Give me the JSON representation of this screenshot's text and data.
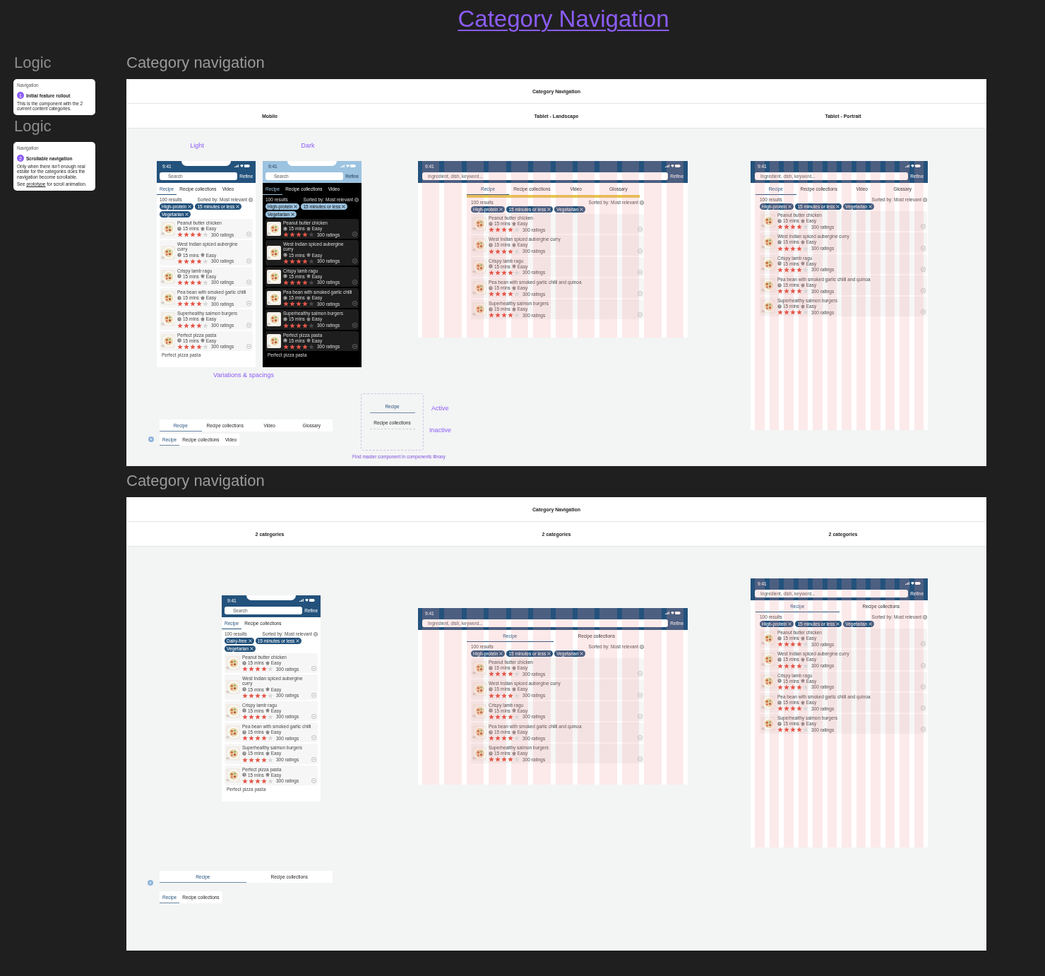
{
  "page_title": "Category Navigation",
  "logic": {
    "headings": [
      "Logic",
      "Logic"
    ],
    "cards": [
      {
        "heading": "Navigation",
        "number": "1",
        "title": "Initial feature rollout",
        "paragraphs": [
          {
            "text": "This is the component with the 2 current content categories."
          }
        ]
      },
      {
        "heading": "Navigation",
        "number": "2",
        "title": "Scrollable navigation",
        "paragraphs": [
          {
            "text": "Only when there isn't enough real estate for the categories does the navigation become scrollable."
          },
          {
            "before": "See ",
            "link": "prototype",
            "after": " for scroll animation."
          }
        ]
      }
    ]
  },
  "sections": [
    {
      "heading": "Category navigation",
      "board_title": "Category Navigation",
      "columns": [
        "Mobile",
        "Tablet - Landscape",
        "Tablet - Portrait"
      ],
      "labels": [
        "Light",
        "Dark",
        "Variations & spacings"
      ],
      "screens": [
        {
          "kind": "mobile",
          "dark": false,
          "grid": false,
          "highlight": false,
          "time": "9:41",
          "search_placeholder": "Search",
          "refine": "Refine",
          "tabs": [
            {
              "label": "Recipe",
              "selected": true
            },
            {
              "label": "Recipe collections",
              "selected": false
            },
            {
              "label": "Video",
              "selected": false
            }
          ],
          "results": "100 results",
          "sort": "Sorted by: Most relevant",
          "chips": [
            "High-protein",
            "15 minutes or less",
            "Vegetarian"
          ],
          "recipes": [
            {
              "name": "Peanut butter chicken",
              "time": "15 mins",
              "difficulty": "Easy",
              "stars": 4,
              "ratings": "300 ratings"
            },
            {
              "name": "West Indian spiced aubergine curry",
              "time": "15 mins",
              "difficulty": "Easy",
              "stars": 4,
              "ratings": "300 ratings"
            },
            {
              "name": "Crispy lamb ragu",
              "time": "15 mins",
              "difficulty": "Easy",
              "stars": 4,
              "ratings": "300 ratings"
            },
            {
              "name": "Pea bean with smoked garlic chilli",
              "time": "15 mins",
              "difficulty": "Easy",
              "stars": 4,
              "ratings": "300 ratings"
            },
            {
              "name": "Superhealthy salmon burgers",
              "time": "15 mins",
              "difficulty": "Easy",
              "stars": 4,
              "ratings": "300 ratings"
            },
            {
              "name": "Perfect pizza pasta",
              "time": "15 mins",
              "difficulty": "Easy",
              "stars": 4,
              "ratings": "300 ratings"
            },
            {
              "name": "Perfect pizza pasta"
            }
          ]
        },
        {
          "kind": "mobile",
          "dark": true,
          "grid": false,
          "highlight": false,
          "time": "9:41",
          "search_placeholder": "Search",
          "refine": "Refine",
          "tabs": [
            {
              "label": "Recipe",
              "selected": true
            },
            {
              "label": "Recipe collections",
              "selected": false
            },
            {
              "label": "Video",
              "selected": false
            }
          ],
          "results": "100 results",
          "sort": "Sorted by: Most relevant",
          "chips": [
            "High-protein",
            "15 minutes or less",
            "Vegetarian"
          ],
          "recipes": [
            {
              "name": "Peanut butter chicken",
              "time": "15 mins",
              "difficulty": "Easy",
              "stars": 4,
              "ratings": "300 ratings"
            },
            {
              "name": "West Indian spiced aubergine curry",
              "time": "15 mins",
              "difficulty": "Easy",
              "stars": 4,
              "ratings": "300 ratings"
            },
            {
              "name": "Crispy lamb ragu",
              "time": "15 mins",
              "difficulty": "Easy",
              "stars": 4,
              "ratings": "300 ratings"
            },
            {
              "name": "Pea bean with smoked garlic chilli",
              "time": "15 mins",
              "difficulty": "Easy",
              "stars": 4,
              "ratings": "300 ratings"
            },
            {
              "name": "Superhealthy salmon burgers",
              "time": "15 mins",
              "difficulty": "Easy",
              "stars": 4,
              "ratings": "300 ratings"
            },
            {
              "name": "Perfect pizza pasta",
              "time": "15 mins",
              "difficulty": "Easy",
              "stars": 4,
              "ratings": "300 ratings"
            },
            {
              "name": "Perfect pizza pasta"
            }
          ]
        },
        {
          "kind": "tablet_landscape",
          "dark": false,
          "grid": true,
          "highlight": true,
          "time": "9:41",
          "search_placeholder": "Ingredient, dish, keyword...",
          "refine": "Refine",
          "tabs": [
            {
              "label": "Recipe",
              "selected": true
            },
            {
              "label": "Recipe collections",
              "selected": false
            },
            {
              "label": "Video",
              "selected": false
            },
            {
              "label": "Glossary",
              "selected": false
            }
          ],
          "results": "100 results",
          "sort": "Sorted by: Most relevant",
          "chips": [
            "High-protein",
            "15 minutes or less",
            "Vegetarian"
          ],
          "recipes": [
            {
              "name": "Peanut butter chicken",
              "time": "15 mins",
              "difficulty": "Easy",
              "stars": 4,
              "ratings": "300 ratings"
            },
            {
              "name": "West Indian spiced aubergine curry",
              "time": "15 mins",
              "difficulty": "Easy",
              "stars": 4,
              "ratings": "300 ratings"
            },
            {
              "name": "Crispy lamb ragu",
              "time": "15 mins",
              "difficulty": "Easy",
              "stars": 4,
              "ratings": "300 ratings"
            },
            {
              "name": "Pea bean with smoked garlic chilli and quinoa",
              "time": "15 mins",
              "difficulty": "Easy",
              "stars": 4,
              "ratings": "300 ratings"
            },
            {
              "name": "Superhealthy salmon burgers",
              "time": "15 mins",
              "difficulty": "Easy",
              "stars": 4,
              "ratings": "300 ratings"
            }
          ]
        },
        {
          "kind": "tablet_portrait",
          "dark": false,
          "grid": true,
          "highlight": false,
          "time": "9:41",
          "search_placeholder": "Ingredient, dish, keyword...",
          "refine": "Refine",
          "tabs": [
            {
              "label": "Recipe",
              "selected": true
            },
            {
              "label": "Recipe collections",
              "selected": false
            },
            {
              "label": "Video",
              "selected": false
            },
            {
              "label": "Glossary",
              "selected": false
            }
          ],
          "results": "100 results",
          "sort": "Sorted by: Most relevant",
          "chips": [
            "High-protein",
            "15 minutes or less",
            "Vegetarian"
          ],
          "recipes": [
            {
              "name": "Peanut butter chicken",
              "time": "15 mins",
              "difficulty": "Easy",
              "stars": 4,
              "ratings": "300 ratings"
            },
            {
              "name": "West Indian spiced aubergine curry",
              "time": "15 mins",
              "difficulty": "Easy",
              "stars": 4,
              "ratings": "300 ratings"
            },
            {
              "name": "Crispy lamb ragu",
              "time": "15 mins",
              "difficulty": "Easy",
              "stars": 4,
              "ratings": "300 ratings"
            },
            {
              "name": "Pea bean with smoked garlic chilli and quinoa",
              "time": "15 mins",
              "difficulty": "Easy",
              "stars": 4,
              "ratings": "300 ratings"
            },
            {
              "name": "Superhealthy salmon burgers",
              "time": "15 mins",
              "difficulty": "Easy",
              "stars": 4,
              "ratings": "300 ratings"
            }
          ]
        }
      ],
      "tab_bars": [
        {
          "kind": "full",
          "tabs": [
            {
              "label": "Recipe",
              "selected": true
            },
            {
              "label": "Recipe collections",
              "selected": false
            },
            {
              "label": "Video",
              "selected": false
            },
            {
              "label": "Glossary",
              "selected": false
            }
          ]
        },
        {
          "kind": "scroll",
          "tabs": [
            {
              "label": "Recipe",
              "selected": true
            },
            {
              "label": "Recipe collections",
              "selected": false
            },
            {
              "label": "Video",
              "selected": false
            }
          ]
        }
      ],
      "state_demo": {
        "tabs": [
          {
            "label": "Recipe",
            "selected": true
          },
          {
            "label": "Recipe collections",
            "selected": false
          }
        ],
        "active_label": "Active",
        "inactive_label": "Inactive",
        "note": "Find master component in components library"
      }
    },
    {
      "heading": "Category navigation",
      "board_title": "Category Navigation",
      "columns": [
        "2 categories",
        "2 categories",
        "2 categories"
      ],
      "screens": [
        {
          "kind": "mobile",
          "dark": false,
          "grid": false,
          "highlight": false,
          "time": "9:41",
          "search_placeholder": "Search",
          "refine": "Refine",
          "tabs": [
            {
              "label": "Recipe",
              "selected": true
            },
            {
              "label": "Recipe collections",
              "selected": false
            }
          ],
          "results": "100 results",
          "sort": "Sorted by: Most relevant",
          "chips": [
            "Dairy-free",
            "15 minutes or less",
            "Vegetarian"
          ],
          "recipes": [
            {
              "name": "Peanut butter chicken",
              "time": "15 mins",
              "difficulty": "Easy",
              "stars": 4,
              "ratings": "300 ratings"
            },
            {
              "name": "West Indian spiced aubergine curry",
              "time": "15 mins",
              "difficulty": "Easy",
              "stars": 4,
              "ratings": "300 ratings"
            },
            {
              "name": "Crispy lamb ragu",
              "time": "15 mins",
              "difficulty": "Easy",
              "stars": 4,
              "ratings": "300 ratings"
            },
            {
              "name": "Pea bean with smoked garlic chilli",
              "time": "15 mins",
              "difficulty": "Easy",
              "stars": 4,
              "ratings": "300 ratings"
            },
            {
              "name": "Superhealthy salmon burgers",
              "time": "15 mins",
              "difficulty": "Easy",
              "stars": 4,
              "ratings": "300 ratings"
            },
            {
              "name": "Perfect pizza pasta",
              "time": "15 mins",
              "difficulty": "Easy",
              "stars": 4,
              "ratings": "300 ratings"
            },
            {
              "name": "Perfect pizza pasta"
            }
          ]
        },
        {
          "kind": "tablet_landscape",
          "dark": false,
          "grid": true,
          "highlight": false,
          "time": "9:41",
          "search_placeholder": "Ingredient, dish, keyword...",
          "refine": "Refine",
          "tabs": [
            {
              "label": "Recipe",
              "selected": true
            },
            {
              "label": "Recipe collections",
              "selected": false
            }
          ],
          "results": "100 results",
          "sort": "Sorted by: Most relevant",
          "chips": [
            "High-protein",
            "15 minutes or less",
            "Vegetarian"
          ],
          "recipes": [
            {
              "name": "Peanut butter chicken",
              "time": "15 mins",
              "difficulty": "Easy",
              "stars": 4,
              "ratings": "300 ratings"
            },
            {
              "name": "West Indian spiced aubergine curry",
              "time": "15 mins",
              "difficulty": "Easy",
              "stars": 4,
              "ratings": "300 ratings"
            },
            {
              "name": "Crispy lamb ragu",
              "time": "15 mins",
              "difficulty": "Easy",
              "stars": 4,
              "ratings": "300 ratings"
            },
            {
              "name": "Pea bean with smoked garlic chilli and quinoa",
              "time": "15 mins",
              "difficulty": "Easy",
              "stars": 4,
              "ratings": "300 ratings"
            },
            {
              "name": "Superhealthy salmon burgers",
              "time": "15 mins",
              "difficulty": "Easy",
              "stars": 4,
              "ratings": "300 ratings"
            }
          ]
        },
        {
          "kind": "tablet_portrait",
          "dark": false,
          "grid": true,
          "highlight": false,
          "time": "9:41",
          "search_placeholder": "Ingredient, dish, keyword...",
          "refine": "Refine",
          "tabs": [
            {
              "label": "Recipe",
              "selected": true
            },
            {
              "label": "Recipe collections",
              "selected": false
            }
          ],
          "results": "100 results",
          "sort": "Sorted by: Most relevant",
          "chips": [
            "High-protein",
            "15 minutes or less",
            "Vegetarian"
          ],
          "recipes": [
            {
              "name": "Peanut butter chicken",
              "time": "15 mins",
              "difficulty": "Easy",
              "stars": 4,
              "ratings": "300 ratings"
            },
            {
              "name": "West Indian spiced aubergine curry",
              "time": "15 mins",
              "difficulty": "Easy",
              "stars": 4,
              "ratings": "300 ratings"
            },
            {
              "name": "Crispy lamb ragu",
              "time": "15 mins",
              "difficulty": "Easy",
              "stars": 4,
              "ratings": "300 ratings"
            },
            {
              "name": "Pea bean with smoked garlic chilli and quinoa",
              "time": "15 mins",
              "difficulty": "Easy",
              "stars": 4,
              "ratings": "300 ratings"
            },
            {
              "name": "Superhealthy salmon burgers",
              "time": "15 mins",
              "difficulty": "Easy",
              "stars": 4,
              "ratings": "300 ratings"
            }
          ]
        }
      ],
      "tab_bars": [
        {
          "kind": "full",
          "tabs": [
            {
              "label": "Recipe",
              "selected": true
            },
            {
              "label": "Recipe collections",
              "selected": false
            }
          ]
        },
        {
          "kind": "scroll",
          "tabs": [
            {
              "label": "Recipe",
              "selected": true
            },
            {
              "label": "Recipe collections",
              "selected": false
            }
          ]
        }
      ]
    }
  ]
}
